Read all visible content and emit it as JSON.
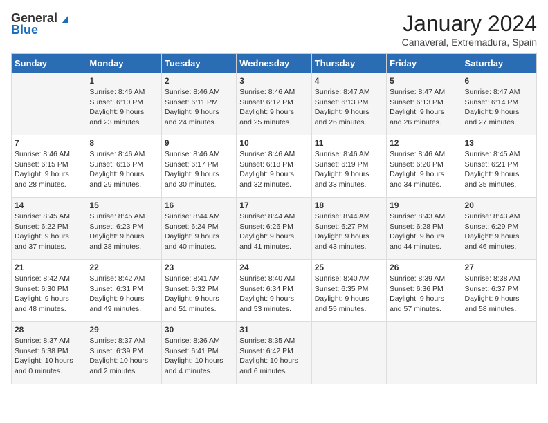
{
  "logo": {
    "line1": "General",
    "line2": "Blue"
  },
  "title": "January 2024",
  "subtitle": "Canaveral, Extremadura, Spain",
  "days_header": [
    "Sunday",
    "Monday",
    "Tuesday",
    "Wednesday",
    "Thursday",
    "Friday",
    "Saturday"
  ],
  "weeks": [
    [
      {
        "day": "",
        "info": ""
      },
      {
        "day": "1",
        "info": "Sunrise: 8:46 AM\nSunset: 6:10 PM\nDaylight: 9 hours\nand 23 minutes."
      },
      {
        "day": "2",
        "info": "Sunrise: 8:46 AM\nSunset: 6:11 PM\nDaylight: 9 hours\nand 24 minutes."
      },
      {
        "day": "3",
        "info": "Sunrise: 8:46 AM\nSunset: 6:12 PM\nDaylight: 9 hours\nand 25 minutes."
      },
      {
        "day": "4",
        "info": "Sunrise: 8:47 AM\nSunset: 6:13 PM\nDaylight: 9 hours\nand 26 minutes."
      },
      {
        "day": "5",
        "info": "Sunrise: 8:47 AM\nSunset: 6:13 PM\nDaylight: 9 hours\nand 26 minutes."
      },
      {
        "day": "6",
        "info": "Sunrise: 8:47 AM\nSunset: 6:14 PM\nDaylight: 9 hours\nand 27 minutes."
      }
    ],
    [
      {
        "day": "7",
        "info": "Sunrise: 8:46 AM\nSunset: 6:15 PM\nDaylight: 9 hours\nand 28 minutes."
      },
      {
        "day": "8",
        "info": "Sunrise: 8:46 AM\nSunset: 6:16 PM\nDaylight: 9 hours\nand 29 minutes."
      },
      {
        "day": "9",
        "info": "Sunrise: 8:46 AM\nSunset: 6:17 PM\nDaylight: 9 hours\nand 30 minutes."
      },
      {
        "day": "10",
        "info": "Sunrise: 8:46 AM\nSunset: 6:18 PM\nDaylight: 9 hours\nand 32 minutes."
      },
      {
        "day": "11",
        "info": "Sunrise: 8:46 AM\nSunset: 6:19 PM\nDaylight: 9 hours\nand 33 minutes."
      },
      {
        "day": "12",
        "info": "Sunrise: 8:46 AM\nSunset: 6:20 PM\nDaylight: 9 hours\nand 34 minutes."
      },
      {
        "day": "13",
        "info": "Sunrise: 8:45 AM\nSunset: 6:21 PM\nDaylight: 9 hours\nand 35 minutes."
      }
    ],
    [
      {
        "day": "14",
        "info": "Sunrise: 8:45 AM\nSunset: 6:22 PM\nDaylight: 9 hours\nand 37 minutes."
      },
      {
        "day": "15",
        "info": "Sunrise: 8:45 AM\nSunset: 6:23 PM\nDaylight: 9 hours\nand 38 minutes."
      },
      {
        "day": "16",
        "info": "Sunrise: 8:44 AM\nSunset: 6:24 PM\nDaylight: 9 hours\nand 40 minutes."
      },
      {
        "day": "17",
        "info": "Sunrise: 8:44 AM\nSunset: 6:26 PM\nDaylight: 9 hours\nand 41 minutes."
      },
      {
        "day": "18",
        "info": "Sunrise: 8:44 AM\nSunset: 6:27 PM\nDaylight: 9 hours\nand 43 minutes."
      },
      {
        "day": "19",
        "info": "Sunrise: 8:43 AM\nSunset: 6:28 PM\nDaylight: 9 hours\nand 44 minutes."
      },
      {
        "day": "20",
        "info": "Sunrise: 8:43 AM\nSunset: 6:29 PM\nDaylight: 9 hours\nand 46 minutes."
      }
    ],
    [
      {
        "day": "21",
        "info": "Sunrise: 8:42 AM\nSunset: 6:30 PM\nDaylight: 9 hours\nand 48 minutes."
      },
      {
        "day": "22",
        "info": "Sunrise: 8:42 AM\nSunset: 6:31 PM\nDaylight: 9 hours\nand 49 minutes."
      },
      {
        "day": "23",
        "info": "Sunrise: 8:41 AM\nSunset: 6:32 PM\nDaylight: 9 hours\nand 51 minutes."
      },
      {
        "day": "24",
        "info": "Sunrise: 8:40 AM\nSunset: 6:34 PM\nDaylight: 9 hours\nand 53 minutes."
      },
      {
        "day": "25",
        "info": "Sunrise: 8:40 AM\nSunset: 6:35 PM\nDaylight: 9 hours\nand 55 minutes."
      },
      {
        "day": "26",
        "info": "Sunrise: 8:39 AM\nSunset: 6:36 PM\nDaylight: 9 hours\nand 57 minutes."
      },
      {
        "day": "27",
        "info": "Sunrise: 8:38 AM\nSunset: 6:37 PM\nDaylight: 9 hours\nand 58 minutes."
      }
    ],
    [
      {
        "day": "28",
        "info": "Sunrise: 8:37 AM\nSunset: 6:38 PM\nDaylight: 10 hours\nand 0 minutes."
      },
      {
        "day": "29",
        "info": "Sunrise: 8:37 AM\nSunset: 6:39 PM\nDaylight: 10 hours\nand 2 minutes."
      },
      {
        "day": "30",
        "info": "Sunrise: 8:36 AM\nSunset: 6:41 PM\nDaylight: 10 hours\nand 4 minutes."
      },
      {
        "day": "31",
        "info": "Sunrise: 8:35 AM\nSunset: 6:42 PM\nDaylight: 10 hours\nand 6 minutes."
      },
      {
        "day": "",
        "info": ""
      },
      {
        "day": "",
        "info": ""
      },
      {
        "day": "",
        "info": ""
      }
    ]
  ]
}
